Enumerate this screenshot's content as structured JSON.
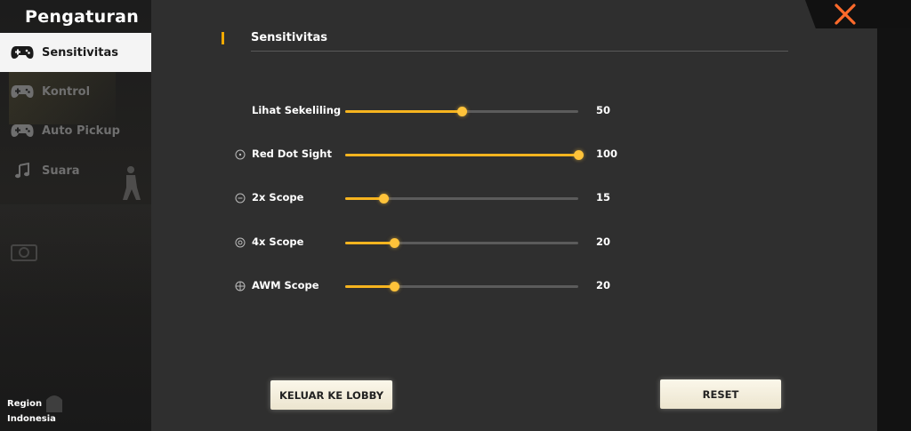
{
  "sidebar": {
    "title": "Pengaturan",
    "items": [
      {
        "label": "Sensitivitas",
        "icon": "gamepad-icon",
        "active": true
      },
      {
        "label": "Kontrol",
        "icon": "gamepad-icon",
        "active": false
      },
      {
        "label": "Auto Pickup",
        "icon": "gamepad-icon",
        "active": false
      },
      {
        "label": "Suara",
        "icon": "music-note-icon",
        "active": false
      }
    ],
    "region_label": "Region",
    "region_value": "Indonesia"
  },
  "section": {
    "title": "Sensitivitas"
  },
  "sliders": [
    {
      "label": "Lihat Sekeliling",
      "value": "50",
      "fraction": 0.5,
      "icon": ""
    },
    {
      "label": "Red Dot Sight",
      "value": "100",
      "fraction": 1.0,
      "icon": "red-dot-sight-icon"
    },
    {
      "label": "2x Scope",
      "value": "15",
      "fraction": 0.165,
      "icon": "scope-2x-icon"
    },
    {
      "label": "4x Scope",
      "value": "20",
      "fraction": 0.21,
      "icon": "scope-4x-icon"
    },
    {
      "label": "AWM Scope",
      "value": "20",
      "fraction": 0.21,
      "icon": "awm-scope-icon"
    }
  ],
  "buttons": {
    "exit_lobby": "KELUAR KE LOBBY",
    "reset": "RESET"
  },
  "colors": {
    "accent": "#f6b41f",
    "close": "#ff6a2b"
  }
}
